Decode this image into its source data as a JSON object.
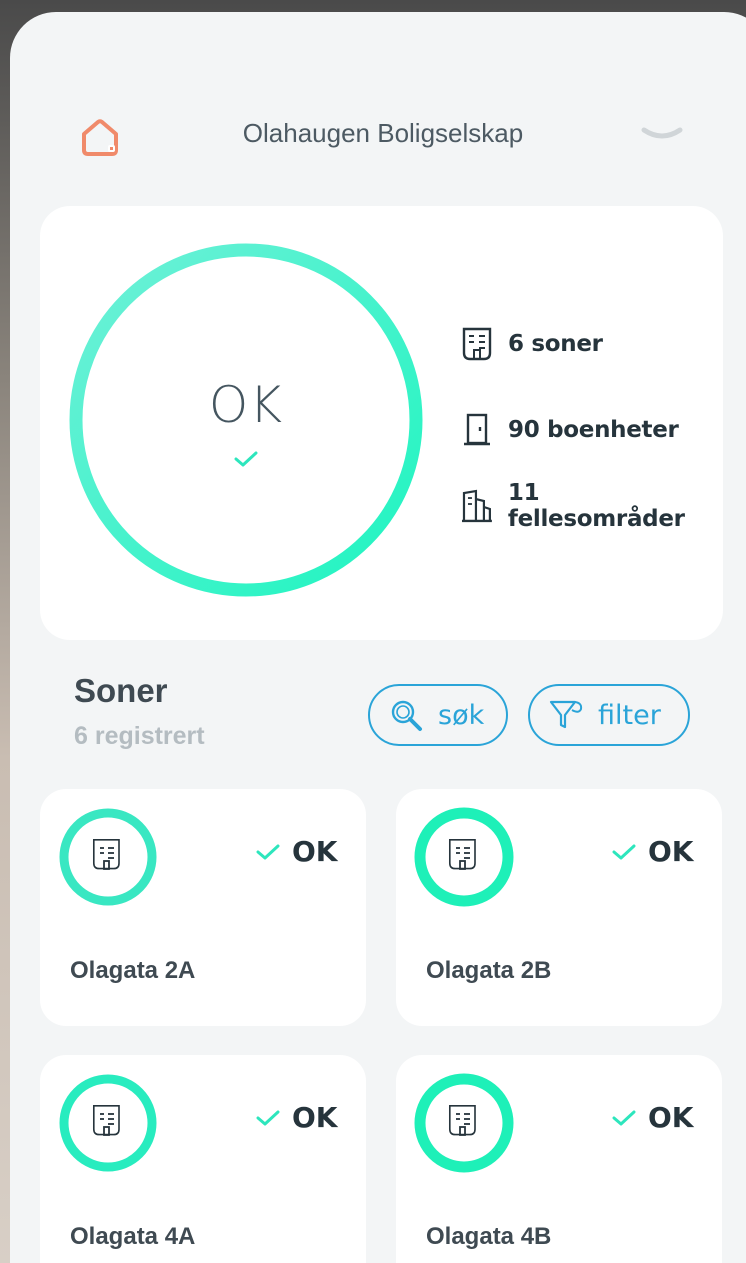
{
  "header": {
    "org_name": "Olahaugen Boligselskap",
    "logo_icon": "house-alert-icon",
    "dropdown_icon": "chevron-down-icon",
    "logo_color": "#f08a6a"
  },
  "summary": {
    "status": "OK",
    "status_icon": "check-icon",
    "ring_color": "#2af0c4",
    "stats": [
      {
        "icon": "zone-document-icon",
        "label": "6 soner"
      },
      {
        "icon": "door-icon",
        "label": "90 boenheter"
      },
      {
        "icon": "common-area-building-icon",
        "label": "11 fellesområder"
      }
    ]
  },
  "section": {
    "title": "Soner",
    "subtitle": "6 registrert",
    "search_label": "søk",
    "filter_label": "filter",
    "accent": "#2aa4d8"
  },
  "zones": [
    {
      "name": "Olagata 2A",
      "status": "OK"
    },
    {
      "name": "Olagata 2B",
      "status": "OK"
    },
    {
      "name": "Olagata 4A",
      "status": "OK"
    },
    {
      "name": "Olagata 4B",
      "status": "OK"
    }
  ]
}
